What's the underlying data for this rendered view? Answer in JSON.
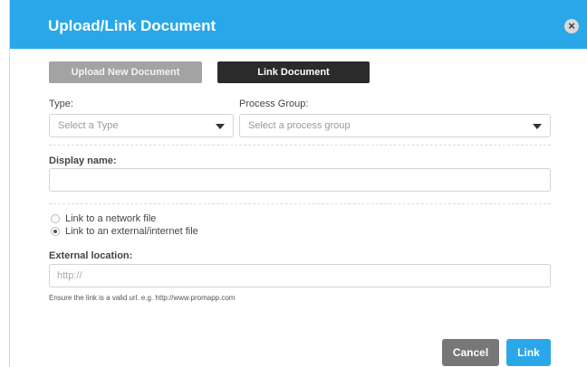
{
  "dialog": {
    "title": "Upload/Link Document",
    "close_icon": "×"
  },
  "tabs": [
    {
      "label": "Upload New Document",
      "active": false
    },
    {
      "label": "Link Document",
      "active": true
    }
  ],
  "form": {
    "type_label": "Type:",
    "type_placeholder": "Select a Type",
    "process_group_label": "Process Group:",
    "process_group_placeholder": "Select a process group",
    "display_name_label": "Display name:",
    "display_name_value": "",
    "link_options": [
      {
        "label": "Link to a network file",
        "selected": false
      },
      {
        "label": "Link to an external/internet file",
        "selected": true
      }
    ],
    "external_location_label": "External location:",
    "external_location_placeholder": "http://",
    "external_location_value": "",
    "hint": "Ensure the link is a valid url. e.g. http://www.promapp.com"
  },
  "buttons": {
    "cancel": "Cancel",
    "link": "Link"
  },
  "colors": {
    "header": "#2aa7e8",
    "active_tab": "#2b2b2b",
    "inactive_tab": "#a3a3a3",
    "cancel_button": "#777777",
    "primary_button": "#2aa7e8"
  }
}
